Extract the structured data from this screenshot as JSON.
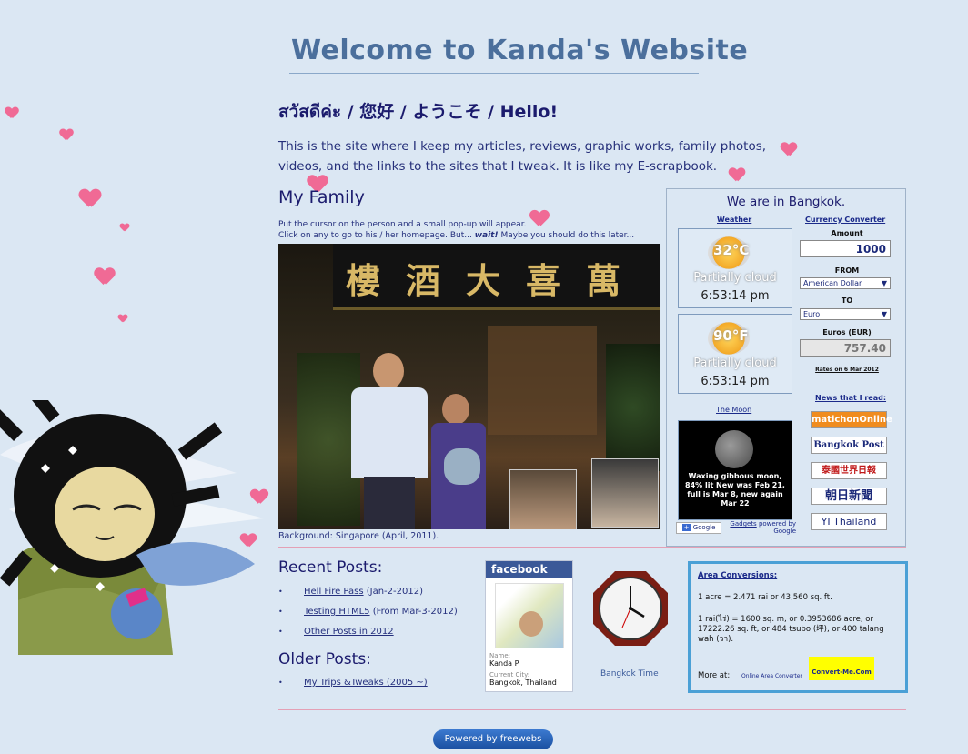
{
  "header": {
    "title": "Welcome to Kanda's Website",
    "greeting": "สวัสดีค่ะ / 您好 / ようこそ / Hello!",
    "intro": "This is the site where I keep my articles, reviews, graphic works, family photos, videos, and the links to the sites that I tweak.   It is like my E-scrapbook."
  },
  "family": {
    "heading": "My Family",
    "note_line1": "Put the cursor on the person and a small pop-up will appear.",
    "note_line2_a": "Click on any to go to his / her homepage. But...",
    "note_wait": "wait!",
    "note_line2_b": " Maybe you should do this later...",
    "sign_chars": [
      "樓",
      "酒",
      "大",
      "喜",
      "萬"
    ],
    "background_caption": "Background: Singapore (April, 2011)."
  },
  "panel": {
    "heading": "We are in Bangkok.",
    "weather_label": "Weather",
    "weather": [
      {
        "temp": "32°C",
        "condition": "Partially cloud",
        "time": "6:53:14 pm"
      },
      {
        "temp": "90°F",
        "condition": "Partially cloud",
        "time": "6:53:14 pm"
      }
    ],
    "moon_label": "The Moon",
    "moon_text": "Waxing gibbous moon, 84% lit New was Feb 21, full is Mar 8, new again Mar 22",
    "google_label": "Google",
    "gadgets_label": "Gadgets",
    "powered_by_google": "powered by Google",
    "currency_label": "Currency Converter",
    "amount_label": "Amount",
    "amount_value": "1000",
    "from_label": "FROM",
    "from_value": "American Dollar",
    "to_label": "TO",
    "to_value": "Euro",
    "result_label": "Euros (EUR)",
    "result_value": "757.40",
    "rates_note": "Rates on 6 Mar 2012",
    "news_label": "News that I read:",
    "news": [
      "matichonOnline",
      "Bangkok Post",
      "泰國世界日報",
      "朝日新聞",
      "YI Thailand"
    ]
  },
  "posts": {
    "recent_heading": "Recent Posts:",
    "recent": [
      {
        "link": "Hell Fire Pass",
        "extra": " (Jan-2-2012)"
      },
      {
        "link": "Testing HTML5",
        "extra": " (From Mar-3-2012)"
      },
      {
        "link": "Other Posts in 2012",
        "extra": ""
      }
    ],
    "older_heading": "Older Posts:",
    "older": [
      {
        "link": "My Trips &Tweaks (2005 ~)",
        "extra": ""
      }
    ]
  },
  "facebook": {
    "header": "facebook",
    "name_label": "Name:",
    "name_value": "Kanda P",
    "city_label": "Current City:",
    "city_value": "Bangkok, Thailand"
  },
  "clock": {
    "caption": "Bangkok Time"
  },
  "area": {
    "heading": "Area Conversions:",
    "line1": "1 acre = 2.471 rai or 43,560 sq. ft.",
    "line2": "1 rai(ไร่) = 1600 sq. m, or 0.3953686 acre, or 17222.26 sq. ft, or 484 tsubo (坪), or 400 talang wah (วา).",
    "more_label": "More at:",
    "more_link": "Online Area Converter",
    "logo_text": "Convert-Me.Com"
  },
  "footer": {
    "powered": "Powered by freewebs"
  },
  "colors": {
    "background": "#dbe7f3",
    "heading": "#4b6f9c",
    "text": "#1b1b6d",
    "accent_border": "#4aa0d6",
    "hearts": "#f06a95"
  }
}
